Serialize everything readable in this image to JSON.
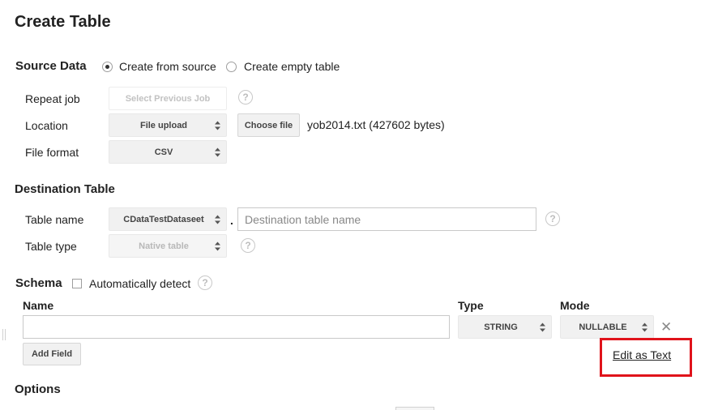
{
  "page": {
    "title": "Create Table"
  },
  "source_data": {
    "heading": "Source Data",
    "radio_from_source": "Create from source",
    "radio_empty": "Create empty table",
    "repeat_job_label": "Repeat job",
    "repeat_job_button": "Select Previous Job",
    "location_label": "Location",
    "location_value": "File upload",
    "choose_file_button": "Choose file",
    "file_info": "yob2014.txt (427602 bytes)",
    "file_format_label": "File format",
    "file_format_value": "CSV"
  },
  "destination": {
    "heading": "Destination Table",
    "table_name_label": "Table name",
    "dataset_value": "CDataTestDataseet",
    "separator": ".",
    "table_name_placeholder": "Destination table name",
    "table_type_label": "Table type",
    "table_type_value": "Native table"
  },
  "schema": {
    "heading": "Schema",
    "auto_detect_label": "Automatically detect",
    "col_name": "Name",
    "col_type": "Type",
    "col_mode": "Mode",
    "type_value": "STRING",
    "mode_value": "NULLABLE",
    "add_field_button": "Add Field",
    "edit_as_text_link": "Edit as Text"
  },
  "options": {
    "heading": "Options"
  },
  "help_glyph": "?",
  "remove_glyph": "✕",
  "colors": {
    "highlight_border": "#e0131b"
  }
}
